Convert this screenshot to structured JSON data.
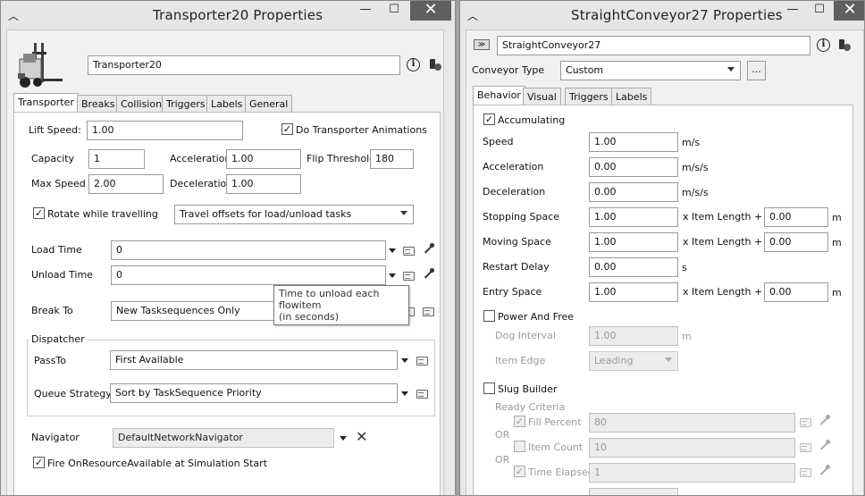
{
  "left_window": {
    "title": "Transporter20  Properties",
    "minimize_glyph": "—",
    "maximize_glyph": "☐",
    "close_glyph": "✕",
    "object_name": "Transporter20",
    "tabs": [
      "Transporter",
      "Breaks",
      "Collision",
      "Triggers",
      "Labels",
      "General"
    ],
    "lift_speed_label": "Lift Speed:",
    "lift_speed": "1.00",
    "do_anim_label": "Do Transporter Animations",
    "capacity_label": "Capacity",
    "capacity": "1",
    "acceleration_label": "Acceleration",
    "acceleration": "1.00",
    "flip_threshold_label": "Flip Threshold",
    "flip_threshold": "180",
    "max_speed_label": "Max Speed",
    "max_speed": "2.00",
    "deceleration_label": "Deceleration",
    "deceleration": "1.00",
    "rotate_label": "Rotate while travelling",
    "travel_offsets": "Travel offsets for load/unload tasks",
    "load_time_label": "Load Time",
    "load_time": "0",
    "unload_time_label": "Unload Time",
    "unload_time": "0",
    "tooltip_line1": "Time to unload each flowitem",
    "tooltip_line2": "(in seconds)",
    "break_to_label": "Break To",
    "break_to": "New Tasksequences Only",
    "dispatcher_label": "Dispatcher",
    "passto_label": "PassTo",
    "passto": "First Available",
    "queue_strategy_label": "Queue Strategy",
    "queue_strategy": "Sort by TaskSequence Priority",
    "navigator_label": "Navigator",
    "navigator": "DefaultNetworkNavigator",
    "fire_label": "Fire OnResourceAvailable at Simulation Start"
  },
  "right_window": {
    "title": "StraightConveyor27  Properties",
    "minimize_glyph": "—",
    "maximize_glyph": "☐",
    "close_glyph": "✕",
    "object_name": "StraightConveyor27",
    "conveyor_type_label": "Conveyor Type",
    "conveyor_type": "Custom",
    "ellipsis": "...",
    "tabs": [
      "Behavior",
      "Visual",
      "Triggers",
      "Labels"
    ],
    "accumulating_label": "Accumulating",
    "rows": [
      {
        "label": "Speed",
        "value": "1.00",
        "unit": "m/s"
      },
      {
        "label": "Acceleration",
        "value": "0.00",
        "unit": "m/s/s"
      },
      {
        "label": "Deceleration",
        "value": "0.00",
        "unit": "m/s/s"
      },
      {
        "label": "Stopping Space",
        "value": "1.00",
        "x_label": "x  Item Length  +",
        "value2": "0.00",
        "unit": "m"
      },
      {
        "label": "Moving Space",
        "value": "1.00",
        "x_label": "x  Item Length  +",
        "value2": "0.00",
        "unit": "m"
      },
      {
        "label": "Restart Delay",
        "value": "0.00",
        "unit": "s"
      },
      {
        "label": "Entry Space",
        "value": "1.00",
        "x_label": "x  Item Length  +",
        "value2": "0.00",
        "unit": "m"
      }
    ],
    "power_free_label": "Power And Free",
    "dog_interval_label": "Dog Interval",
    "dog_interval": "1.00",
    "dog_unit": "m",
    "item_edge_label": "Item Edge",
    "item_edge": "Leading",
    "slug_builder_label": "Slug Builder",
    "ready_criteria_label": "Ready Criteria",
    "or_label": "OR",
    "fill_percent_label": "Fill Percent",
    "fill_percent": "80",
    "item_count_label": "Item Count",
    "item_count": "10",
    "time_elapsed_label": "Time Elapsed",
    "time_elapsed": "1"
  }
}
